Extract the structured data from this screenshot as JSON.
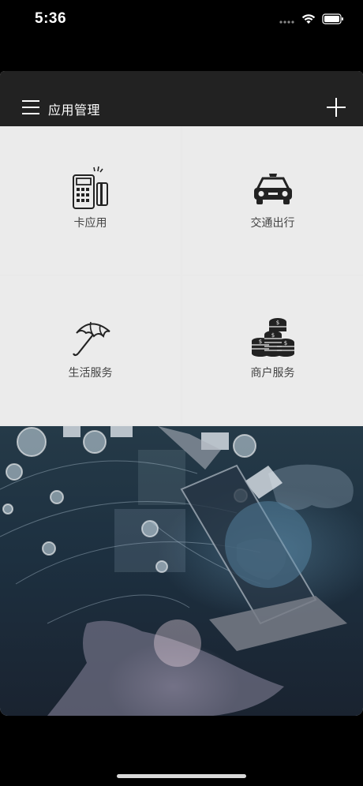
{
  "status": {
    "time": "5:36"
  },
  "nav": {
    "title": "应用管理"
  },
  "tiles": [
    {
      "label": "卡应用",
      "icon": "pos-card-icon"
    },
    {
      "label": "交通出行",
      "icon": "taxi-icon"
    },
    {
      "label": "生活服务",
      "icon": "umbrella-icon"
    },
    {
      "label": "商户服务",
      "icon": "coins-icon"
    }
  ],
  "banner": {
    "image": "technology-laptop-hand-banner"
  },
  "colors": {
    "nav_bg": "#222222",
    "tile_bg": "#ebebeb",
    "accent": "#ffffff"
  }
}
